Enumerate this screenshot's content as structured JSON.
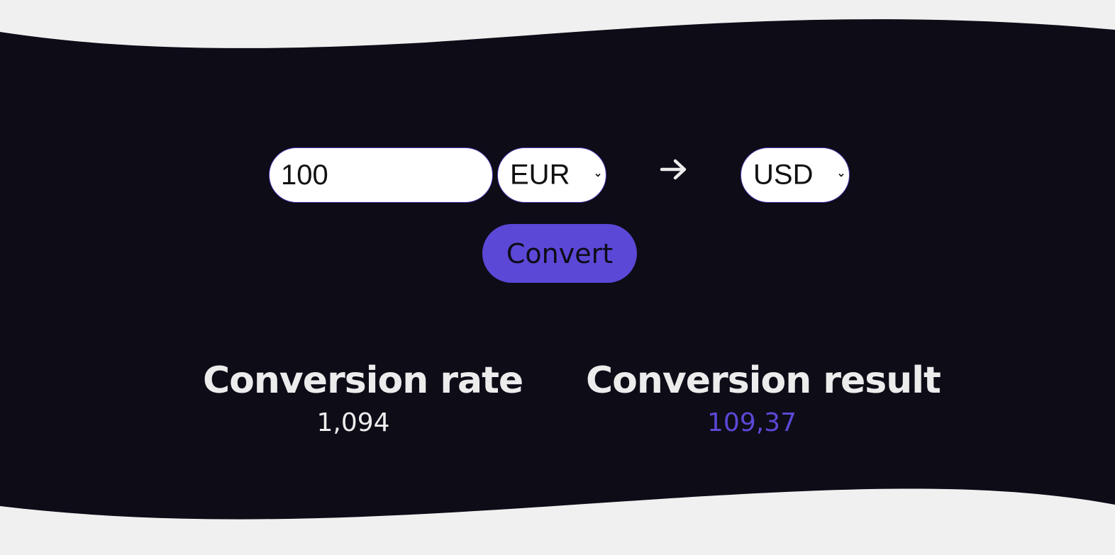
{
  "converter": {
    "amount_value": "100",
    "from_currency": "EUR",
    "to_currency": "USD",
    "arrow_icon": "right-arrow-icon",
    "convert_label": "Convert"
  },
  "results": {
    "rate_heading": "Conversion rate",
    "rate_value": "1,094",
    "result_heading": "Conversion result",
    "result_value": "109,37"
  },
  "colors": {
    "background_dark": "#0d0c17",
    "page_light": "#f0f0f0",
    "accent": "#5b48d6",
    "text_light": "#ececec"
  }
}
